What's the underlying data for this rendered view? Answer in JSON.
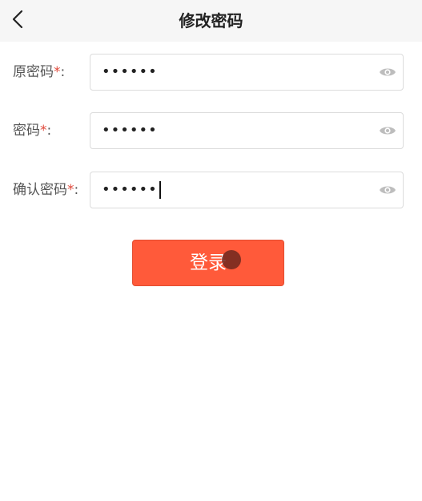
{
  "header": {
    "title": "修改密码",
    "back_icon": "chevron-left-icon"
  },
  "form": {
    "fields": [
      {
        "label": "原密码",
        "required_mark": "*",
        "suffix": ":",
        "value": "••••••",
        "icon": "eye-icon"
      },
      {
        "label": "密码",
        "required_mark": "*",
        "suffix": ":",
        "value": "••••••",
        "icon": "eye-icon"
      },
      {
        "label": "确认密码",
        "required_mark": "*",
        "suffix": ":",
        "value": "••••••",
        "icon": "eye-icon"
      }
    ],
    "submit_label": "登录"
  },
  "colors": {
    "accent": "#ff5a3a",
    "required": "#e0483a",
    "header_bg": "#f6f6f6"
  }
}
